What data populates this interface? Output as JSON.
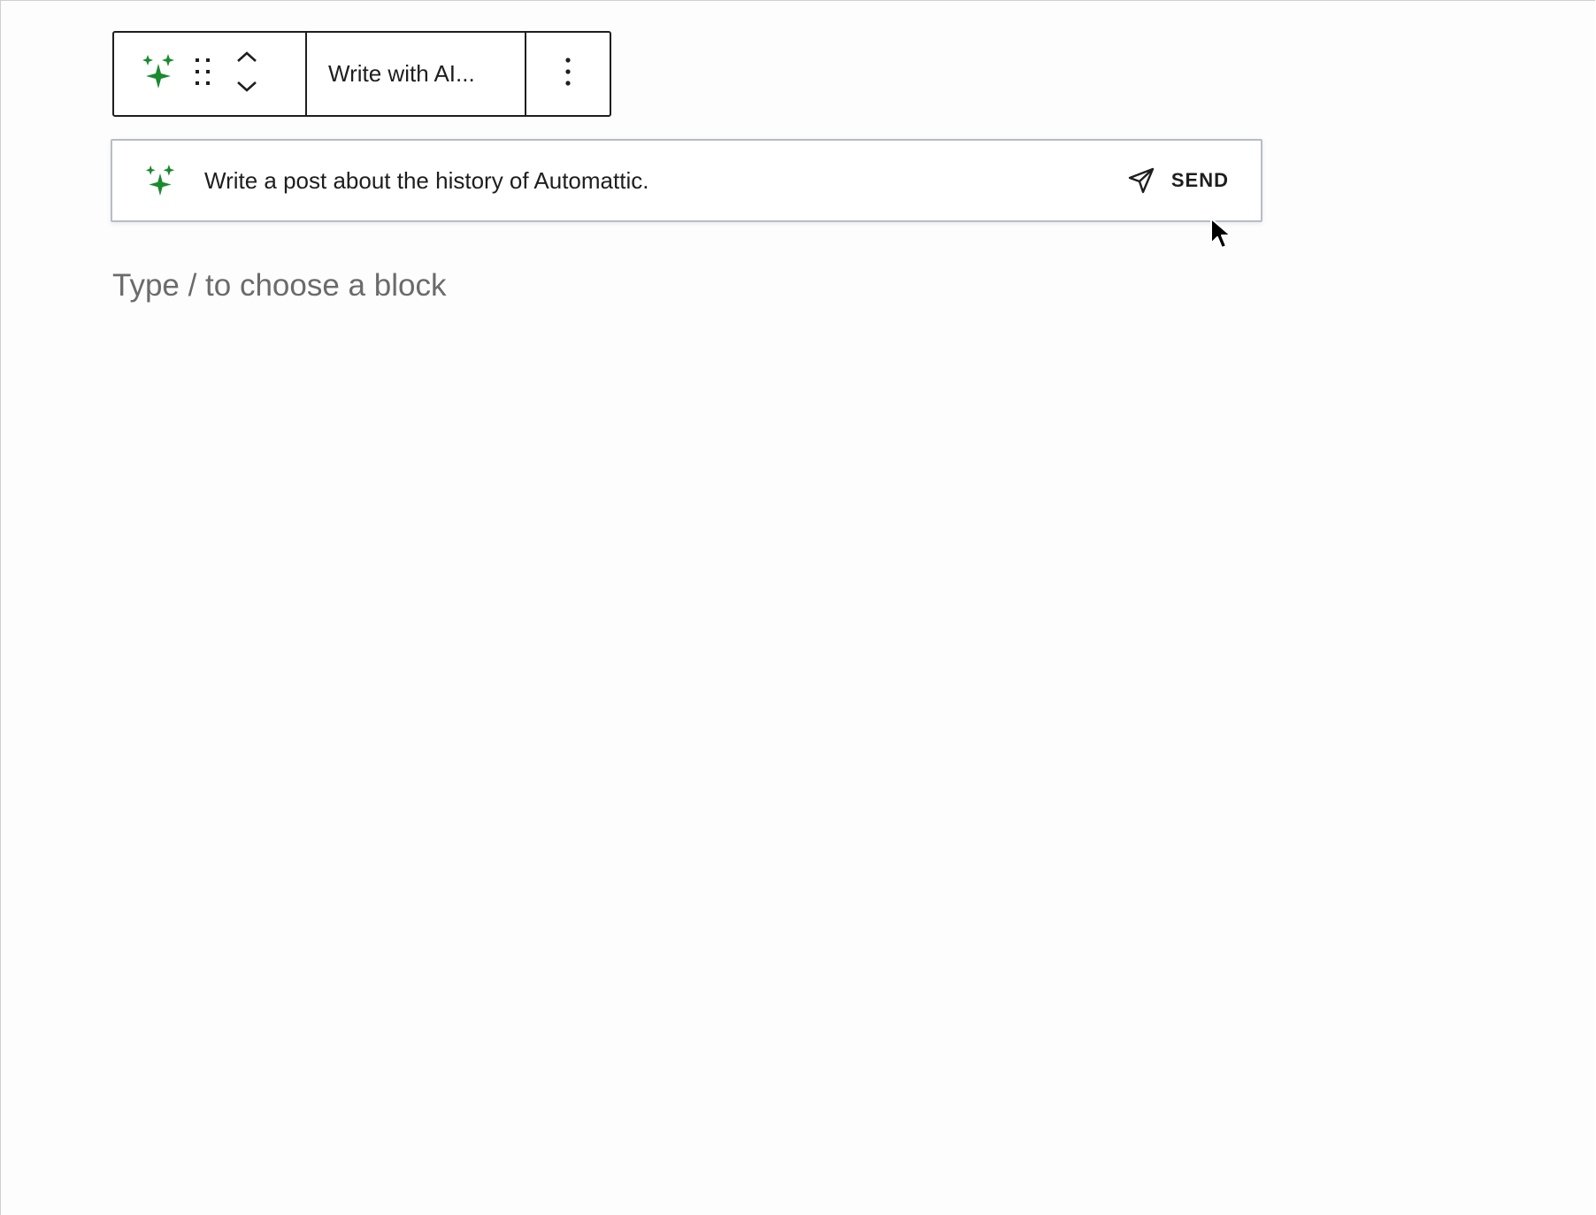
{
  "toolbar": {
    "ai_icon": "sparkles-icon",
    "drag_icon": "drag-handle-icon",
    "move_up_icon": "chevron-up-icon",
    "move_down_icon": "chevron-down-icon",
    "block_title": "Write with AI...",
    "more_icon": "more-vertical-icon"
  },
  "ai_prompt": {
    "icon": "sparkles-icon",
    "value": "Write a post about the history of Automattic.",
    "send_icon": "send-icon",
    "send_label": "SEND"
  },
  "editor": {
    "placeholder": "Type / to choose a block"
  },
  "colors": {
    "sparkle": "#1a8a2e",
    "border": "#1e1e1e",
    "input_border": "#b7bdc7",
    "placeholder": "#6b6b6b"
  }
}
